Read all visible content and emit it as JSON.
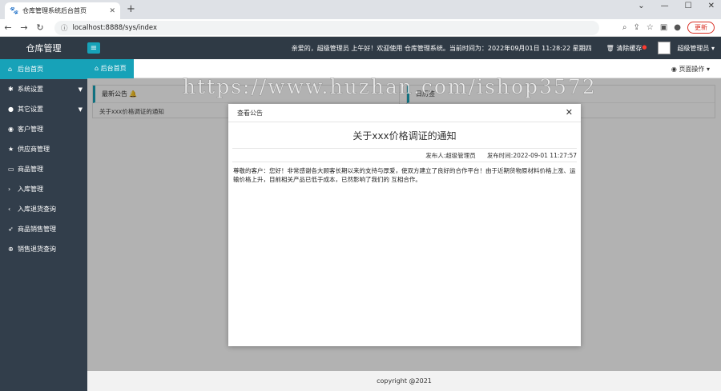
{
  "browser": {
    "tab_title": "仓库管理系统后台首页",
    "url": "localhost:8888/sys/index",
    "update_label": "更新"
  },
  "header": {
    "logo": "仓库管理",
    "welcome": "亲爱的，超级管理员 上午好！欢迎使用 仓库管理系统。当前时间为：2022年09月01日 11:28:22   星期四",
    "clear_cache": "清除缓存",
    "user": "超级管理员"
  },
  "sidebar": {
    "items": [
      {
        "label": "后台首页",
        "icon": "home-icon"
      },
      {
        "label": "系统设置",
        "icon": "gear-icon"
      },
      {
        "label": "其它设置",
        "icon": "circle-icon"
      },
      {
        "label": "客户管理",
        "icon": "target-icon"
      },
      {
        "label": "供应商管理",
        "icon": "star-icon"
      },
      {
        "label": "商品管理",
        "icon": "box-icon"
      },
      {
        "label": "入库管理",
        "icon": "chevron-right-icon"
      },
      {
        "label": "入库退货查询",
        "icon": "chevron-left-icon"
      },
      {
        "label": "商品销售管理",
        "icon": "send-icon"
      },
      {
        "label": "销售退货查询",
        "icon": "cart-icon"
      }
    ]
  },
  "tabs": {
    "home": "后台首页",
    "page_ops": "页面操作"
  },
  "cards": {
    "latest_notice": "最新公告",
    "notice_item": "关于xxx价格调证的通知",
    "right_card_title": "日历签"
  },
  "footer": "copyright @2021",
  "modal": {
    "title": "查看公告",
    "notice_title": "关于xxx价格调证的通知",
    "publisher": "发布人:超级管理员",
    "publish_time": "发布时间:2022-09-01 11:27:57",
    "body": "尊敬的客户：您好！非常感谢各大顾客长期以来的支持与厚爱，使双方建立了良好的合作平台！由于近期货物原材料价格上涨、运输价格上升，目前相关产品已低于成本，已然影响了我们的 互相合作。"
  },
  "watermark": "https://www.huzhan.com/ishop3572",
  "colors": {
    "accent": "#17a2b8",
    "sidebar": "#323e4b",
    "header": "#2f3a45"
  }
}
